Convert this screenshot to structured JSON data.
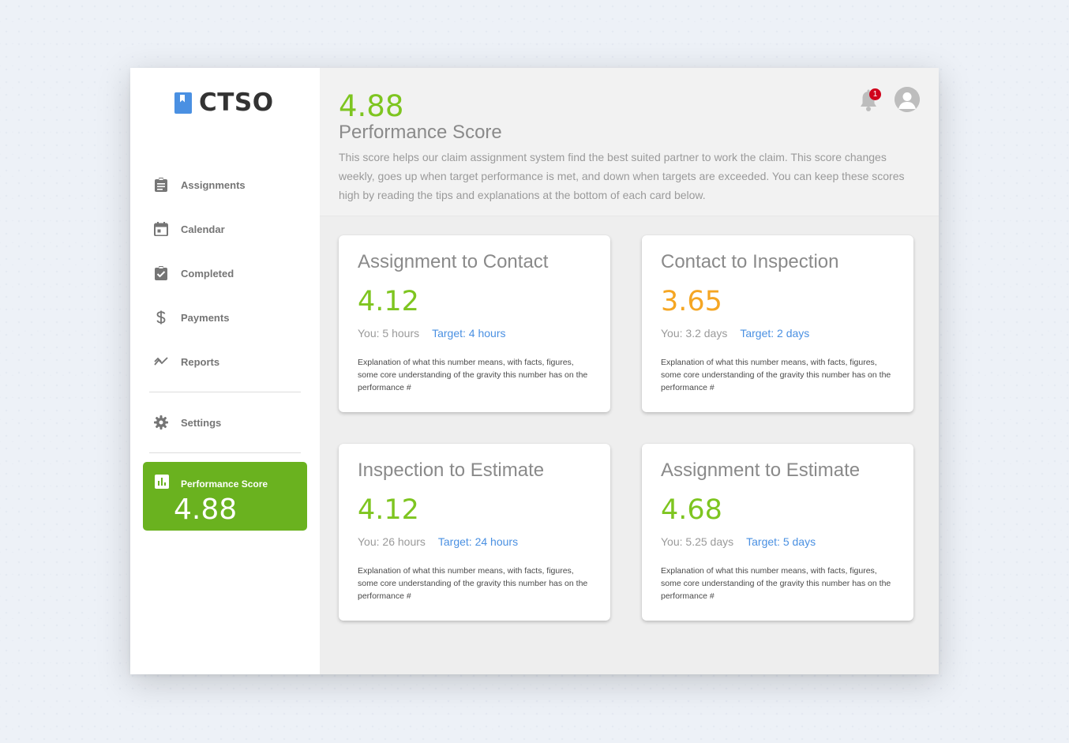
{
  "colors": {
    "accent_green": "#7ec520",
    "sidebar_active": "#6ab21f",
    "warning_orange": "#f5a623",
    "link_blue": "#4a90e2",
    "badge_red": "#d0021b"
  },
  "brand": {
    "name": "CTSO",
    "icon": "bookmark-icon"
  },
  "sidebar": {
    "items": [
      {
        "label": "Assignments",
        "icon": "clipboard-icon"
      },
      {
        "label": "Calendar",
        "icon": "calendar-icon"
      },
      {
        "label": "Completed",
        "icon": "clipboard-check-icon"
      },
      {
        "label": "Payments",
        "icon": "dollar-icon"
      },
      {
        "label": "Reports",
        "icon": "trending-icon"
      }
    ],
    "settings": {
      "label": "Settings",
      "icon": "gear-icon"
    },
    "performance": {
      "label": "Performance Score",
      "value": "4.88",
      "icon": "bar-chart-icon"
    }
  },
  "header": {
    "score": "4.88",
    "title": "Performance Score",
    "description": "This score helps our claim assignment system find the best suited partner to work the claim. This score changes weekly, goes up when target performance is met, and down when targets are exceeded. You can keep these scores high by reading the tips and explanations at the bottom of each card below.",
    "notifications": {
      "count": "1",
      "icon": "bell-icon"
    },
    "avatar_icon": "user-avatar-icon"
  },
  "cards": [
    {
      "title": "Assignment to Contact",
      "value": "4.12",
      "value_color": "#7ec520",
      "you": "You: 5 hours",
      "target": "Target: 4 hours",
      "explanation": "Explanation of what this number means, with facts, figures, some core understanding of the gravity this number has on the performance #"
    },
    {
      "title": "Contact to Inspection",
      "value": "3.65",
      "value_color": "#f5a623",
      "you": "You: 3.2 days",
      "target": "Target: 2 days",
      "explanation": "Explanation of what this number means, with facts, figures, some core understanding of the gravity this number has on the performance #"
    },
    {
      "title": "Inspection to Estimate",
      "value": "4.12",
      "value_color": "#7ec520",
      "you": "You: 26 hours",
      "target": "Target: 24 hours",
      "explanation": "Explanation of what this number means, with facts, figures, some core understanding of the gravity this number has on the performance #"
    },
    {
      "title": "Assignment to Estimate",
      "value": "4.68",
      "value_color": "#7ec520",
      "you": "You: 5.25 days",
      "target": "Target: 5 days",
      "explanation": "Explanation of what this number means, with facts, figures, some core understanding of the gravity this number has on the performance #"
    }
  ]
}
